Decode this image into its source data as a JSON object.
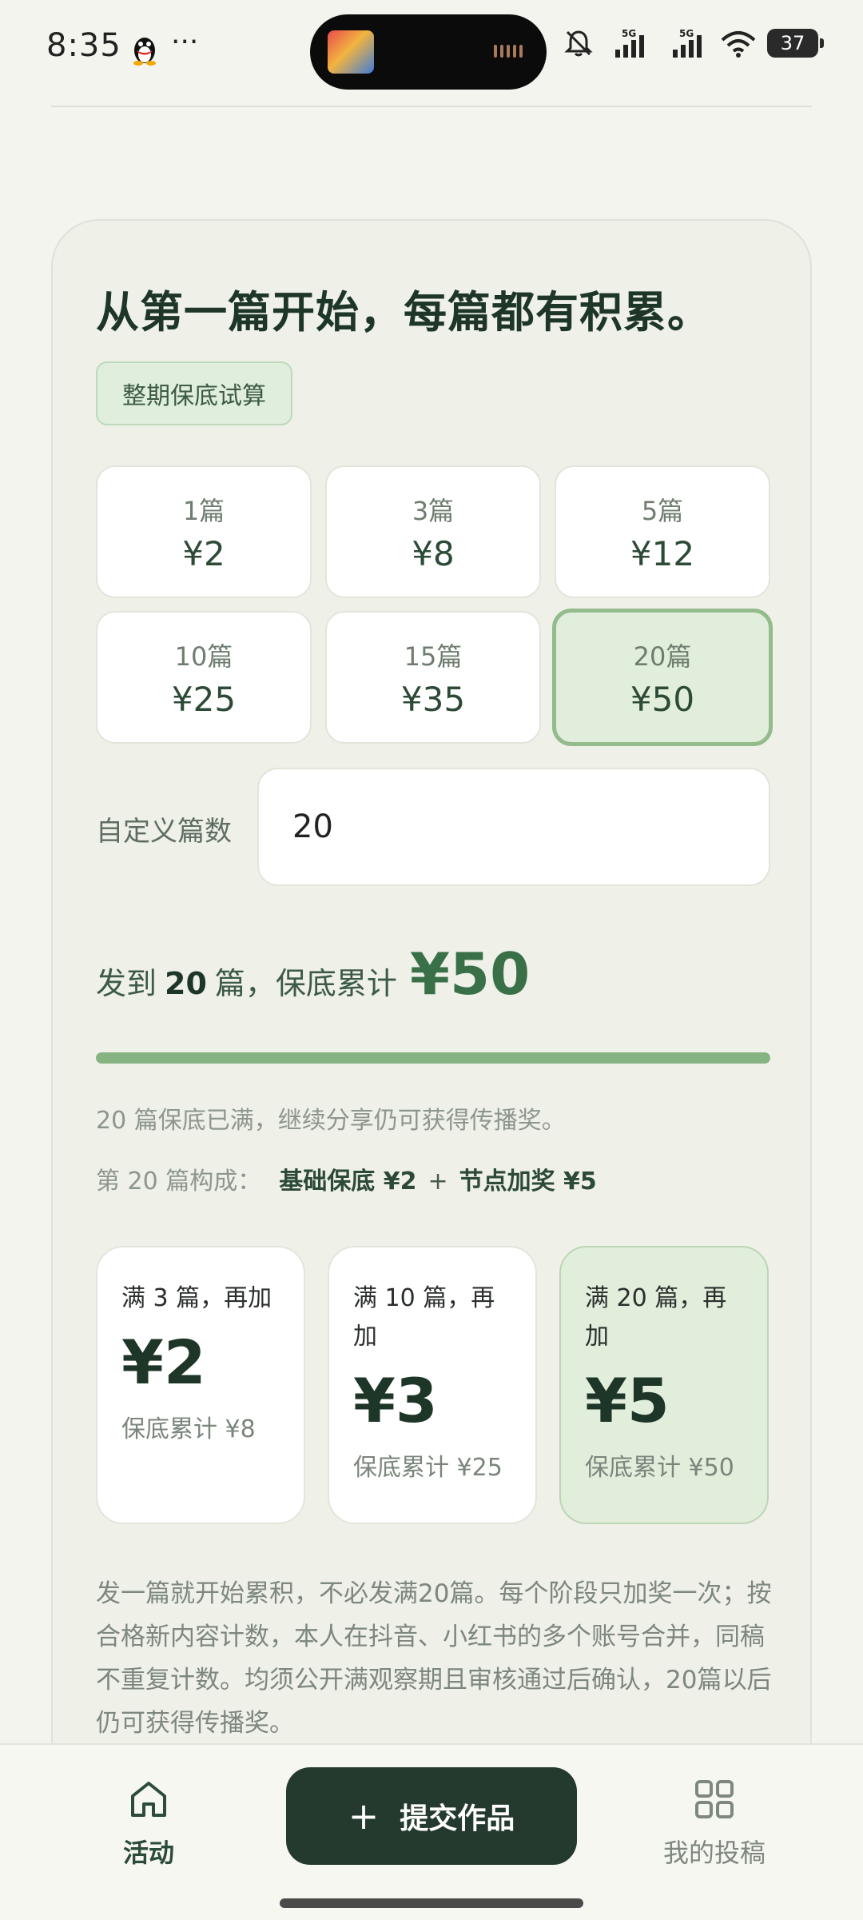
{
  "status_bar": {
    "time": "8:35",
    "dots": "···",
    "battery": "37",
    "network_1": "5G",
    "network_2": "5G"
  },
  "card": {
    "headline": "从第一篇开始，每篇都有积累。",
    "tag": "整期保底试算",
    "options": [
      {
        "count": "1篇",
        "price": "¥2"
      },
      {
        "count": "3篇",
        "price": "¥8"
      },
      {
        "count": "5篇",
        "price": "¥12"
      },
      {
        "count": "10篇",
        "price": "¥25"
      },
      {
        "count": "15篇",
        "price": "¥35"
      },
      {
        "count": "20篇",
        "price": "¥50"
      }
    ],
    "selected_index": 5,
    "custom_label": "自定义篇数",
    "custom_value": "20",
    "summary_prefix": "发到",
    "summary_count": "20",
    "summary_mid": "篇，保底累计",
    "summary_amount": "¥50",
    "progress_percent": 100,
    "note": "20 篇保底已满，继续分享仍可获得传播奖。",
    "composition_label": "第 20 篇构成：",
    "composition_base": "基础保底 ¥2",
    "composition_plus": "+",
    "composition_bonus": "节点加奖 ¥5",
    "bonuses": [
      {
        "title": "满 3 篇，再加",
        "amount": "¥2",
        "sub": "保底累计 ¥8"
      },
      {
        "title": "满 10 篇，再加",
        "amount": "¥3",
        "sub": "保底累计 ¥25"
      },
      {
        "title": "满 20 篇，再加",
        "amount": "¥5",
        "sub": "保底累计 ¥50"
      }
    ],
    "footnote": "发一篇就开始累积，不必发满20篇。每个阶段只加奖一次；按合格新内容计数，本人在抖音、小红书的多个账号合并，同稿不重复计数。均须公开满观察期且审核通过后确认，20篇以后仍可获得传播奖。"
  },
  "nav": {
    "home_label": "活动",
    "submit_label": "提交作品",
    "submit_icon": "plus-icon",
    "mine_label": "我的投稿"
  },
  "colors": {
    "accent_green": "#86b382",
    "dark_button": "#243a2e",
    "selected_bg": "#e1eedc"
  }
}
